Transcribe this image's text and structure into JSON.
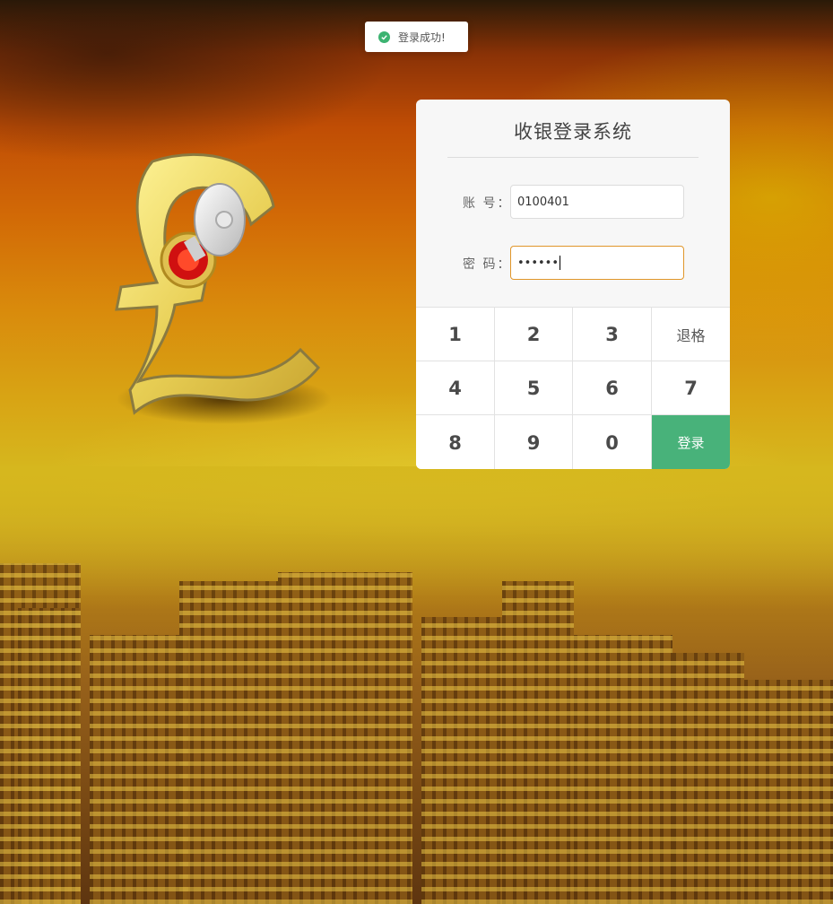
{
  "toast": {
    "message": "登录成功!",
    "icon": "check-circle-icon",
    "color": "#3cb371"
  },
  "emblem": {
    "icon": "pound-key-icon"
  },
  "login": {
    "title": "收银登录系统",
    "account_label": "账 号：",
    "account_value": "0100401",
    "password_label": "密 码：",
    "password_value": "••••••"
  },
  "keypad": {
    "keys": [
      "1",
      "2",
      "3",
      "退格",
      "4",
      "5",
      "6",
      "7",
      "8",
      "9",
      "0",
      "登录"
    ],
    "submit_color": "#48b27a",
    "focus_color": "#e0962a"
  }
}
